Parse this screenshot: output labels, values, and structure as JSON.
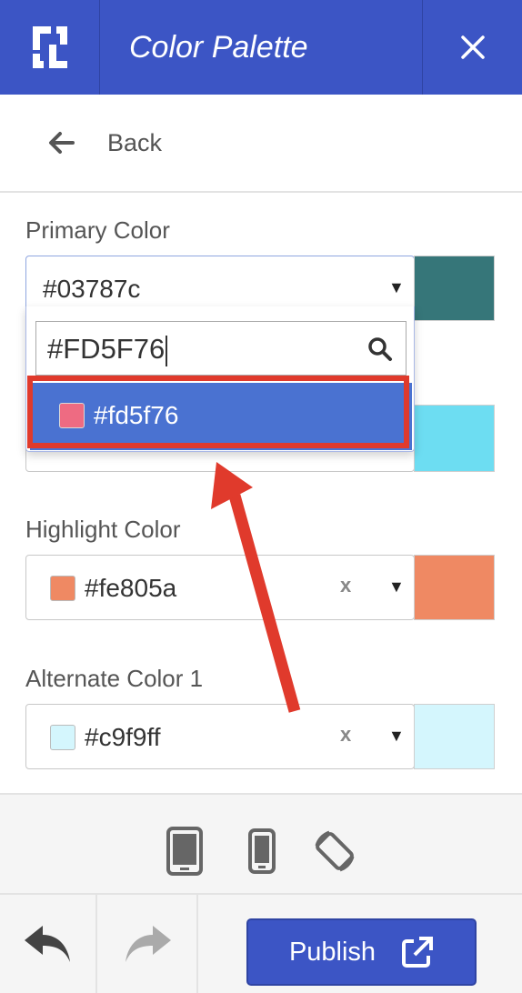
{
  "header": {
    "title": "Color Palette",
    "logo_icon": "app-logo-icon",
    "close_icon": "close-icon",
    "bg_color": "#3c55c5"
  },
  "back": {
    "label": "Back",
    "icon": "arrow-left-icon"
  },
  "primary": {
    "label": "Primary Color",
    "value": "#03787c",
    "swatch_color": "#367679",
    "search_value": "#FD5F76",
    "search_icon": "search-icon",
    "option": {
      "label": "#fd5f76",
      "swatch_color": "#ee6b82"
    },
    "hidden_swatch_color": "#6dddf2"
  },
  "highlight": {
    "label": "Highlight Color",
    "value": "#fe805a",
    "swatch_color": "#ef8963",
    "clear": "x"
  },
  "alternate1": {
    "label": "Alternate Color 1",
    "value": "#c9f9ff",
    "swatch_color": "#d4f6fd",
    "clear": "x"
  },
  "devices": [
    "tablet-icon",
    "phone-icon",
    "rotate-icon"
  ],
  "footer": {
    "undo_icon": "undo-icon",
    "redo_icon": "redo-icon",
    "publish_label": "Publish",
    "publish_icon": "external-link-icon"
  },
  "annotation": {
    "color": "#e03a2c"
  }
}
